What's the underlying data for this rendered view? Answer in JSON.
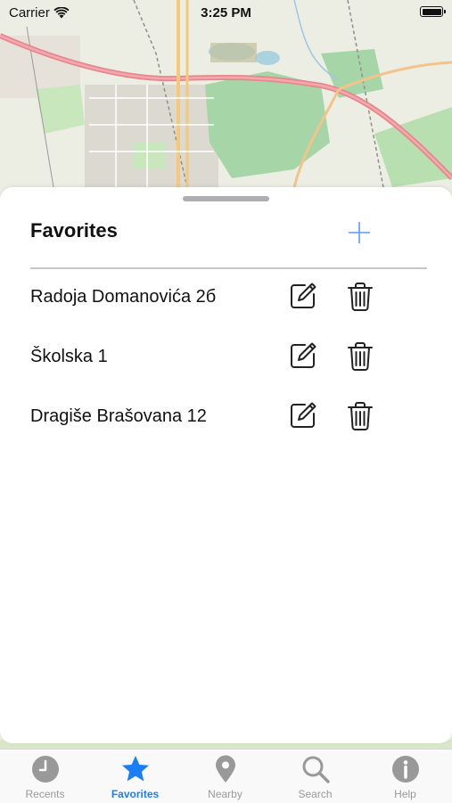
{
  "status_bar": {
    "carrier": "Carrier",
    "time": "3:25 PM"
  },
  "sheet": {
    "title": "Favorites"
  },
  "favorites": [
    {
      "name": "Radoja Domanovića 2б"
    },
    {
      "name": "Školska 1"
    },
    {
      "name": "Dragiše Brašovana 12"
    }
  ],
  "tabs": [
    {
      "label": "Recents",
      "icon": "clock-icon"
    },
    {
      "label": "Favorites",
      "icon": "star-icon",
      "active": true
    },
    {
      "label": "Nearby",
      "icon": "location-pin-icon"
    },
    {
      "label": "Search",
      "icon": "magnifier-icon"
    },
    {
      "label": "Help",
      "icon": "info-icon"
    }
  ],
  "colors": {
    "accent": "#1a7ef7",
    "inactive_tab": "#999999",
    "map_road": "#e8868d"
  }
}
